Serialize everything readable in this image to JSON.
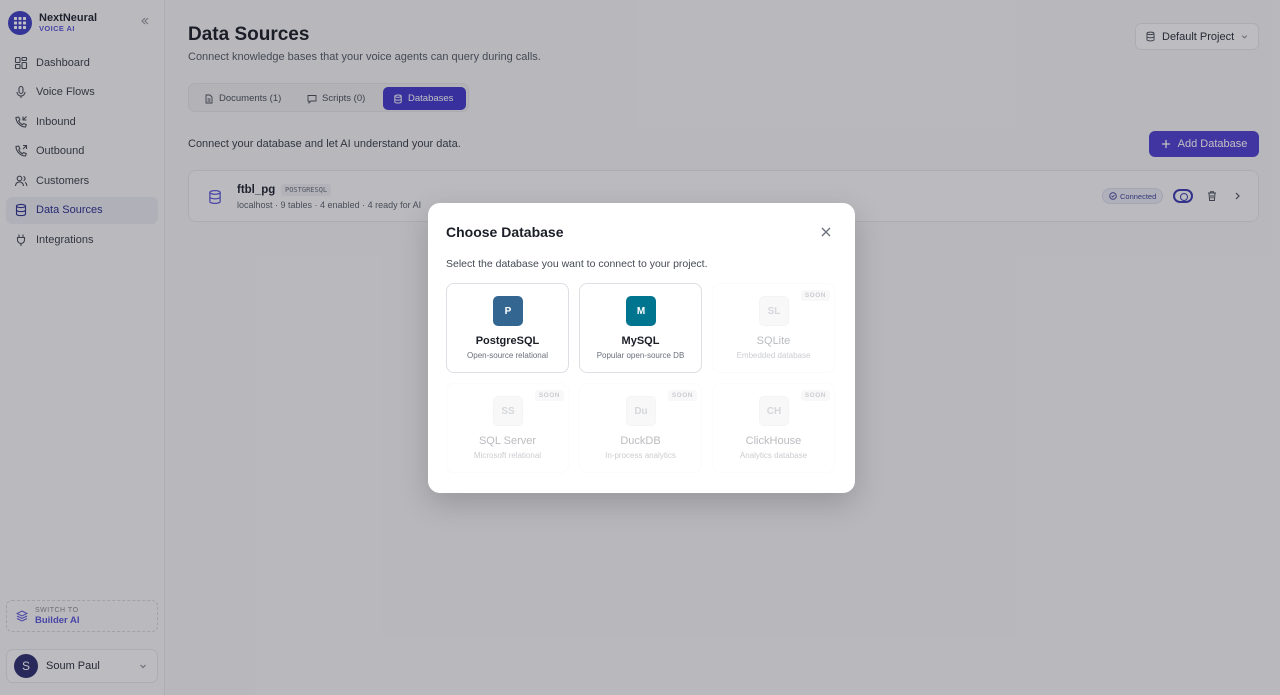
{
  "brand": {
    "name": "NextNeural",
    "subtitle": "VOICE AI"
  },
  "sidebar": {
    "items": [
      {
        "label": "Dashboard",
        "icon": "dashboard-icon"
      },
      {
        "label": "Voice Flows",
        "icon": "microphone-icon"
      },
      {
        "label": "Inbound",
        "icon": "phone-incoming-icon"
      },
      {
        "label": "Outbound",
        "icon": "phone-outgoing-icon"
      },
      {
        "label": "Customers",
        "icon": "users-icon"
      },
      {
        "label": "Data Sources",
        "icon": "database-icon",
        "active": true
      },
      {
        "label": "Integrations",
        "icon": "plug-icon"
      }
    ],
    "switch": {
      "label": "SWITCH TO",
      "target": "Builder AI"
    },
    "user": {
      "initial": "S",
      "name": "Soum Paul"
    }
  },
  "header": {
    "title": "Data Sources",
    "subtitle": "Connect knowledge bases that your voice agents can query during calls.",
    "project": "Default Project"
  },
  "tabs": [
    {
      "label": "Documents (1)"
    },
    {
      "label": "Scripts (0)"
    },
    {
      "label": "Databases",
      "active": true
    }
  ],
  "databases_section": {
    "intro": "Connect your database and let AI understand your data.",
    "add_label": "Add Database",
    "rows": [
      {
        "name": "ftbl_pg",
        "type": "POSTGRESQL",
        "meta": "localhost · 9 tables · 4 enabled · 4 ready for AI",
        "status": "Connected"
      }
    ]
  },
  "modal": {
    "title": "Choose Database",
    "subtitle": "Select the database you want to connect to your project.",
    "options": [
      {
        "logo": "P",
        "name": "PostgreSQL",
        "desc": "Open-source relational",
        "color": "#336791"
      },
      {
        "logo": "M",
        "name": "MySQL",
        "desc": "Popular open-source DB",
        "color": "#00758f"
      },
      {
        "logo": "SL",
        "name": "SQLite",
        "desc": "Embedded database",
        "badge": "SOON"
      },
      {
        "logo": "SS",
        "name": "SQL Server",
        "desc": "Microsoft relational",
        "badge": "SOON"
      },
      {
        "logo": "Du",
        "name": "DuckDB",
        "desc": "In-process analytics",
        "badge": "SOON"
      },
      {
        "logo": "CH",
        "name": "ClickHouse",
        "desc": "Analytics database",
        "badge": "SOON"
      }
    ]
  },
  "colors": {
    "accent": "#4f3fd1",
    "active_tab": "#4338ca"
  }
}
